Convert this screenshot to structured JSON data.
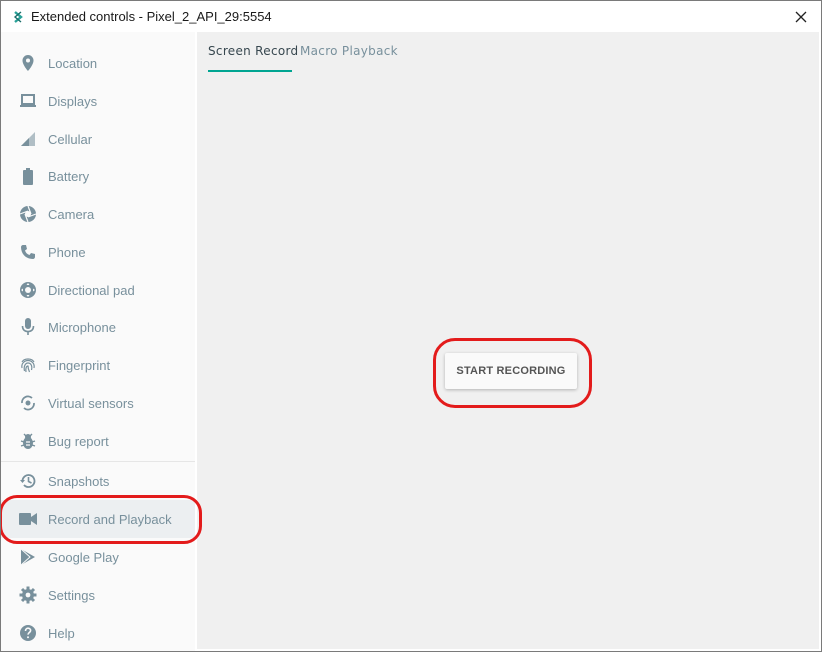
{
  "window": {
    "title": "Extended controls - Pixel_2_API_29:5554",
    "close_glyph": "✕"
  },
  "sidebar": {
    "items": [
      {
        "label": "Location",
        "icon": "location-pin-icon"
      },
      {
        "label": "Displays",
        "icon": "display-icon"
      },
      {
        "label": "Cellular",
        "icon": "cellular-signal-icon"
      },
      {
        "label": "Battery",
        "icon": "battery-icon"
      },
      {
        "label": "Camera",
        "icon": "camera-aperture-icon"
      },
      {
        "label": "Phone",
        "icon": "phone-icon"
      },
      {
        "label": "Directional pad",
        "icon": "dpad-icon"
      },
      {
        "label": "Microphone",
        "icon": "microphone-icon"
      },
      {
        "label": "Fingerprint",
        "icon": "fingerprint-icon"
      },
      {
        "label": "Virtual sensors",
        "icon": "virtual-sensors-icon"
      },
      {
        "label": "Bug report",
        "icon": "bug-icon"
      },
      {
        "label": "Snapshots",
        "icon": "history-icon"
      },
      {
        "label": "Record and Playback",
        "icon": "video-camera-icon",
        "active": true
      },
      {
        "label": "Google Play",
        "icon": "google-play-icon"
      },
      {
        "label": "Settings",
        "icon": "gear-icon"
      },
      {
        "label": "Help",
        "icon": "help-icon"
      }
    ]
  },
  "main": {
    "tabs": [
      {
        "label": "Screen Record",
        "active": true
      },
      {
        "label": "Macro Playback",
        "active": false
      }
    ],
    "start_recording_label": "START RECORDING"
  },
  "colors": {
    "accent": "#00a592",
    "icon": "#78909c",
    "annotation": "#e31b1b",
    "content_bg": "#f0f0f0"
  }
}
